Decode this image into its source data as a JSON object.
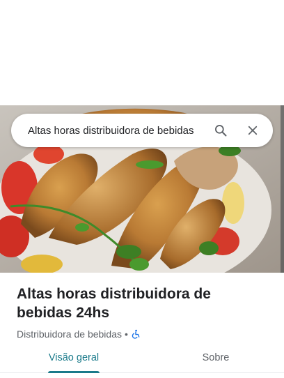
{
  "search": {
    "value": "Altas horas distribuidora de bebidas",
    "search_icon": "search-icon",
    "close_icon": "close-icon"
  },
  "place": {
    "title": "Altas horas distribuidora de bebidas 24hs",
    "category": "Distribuidora de bebidas",
    "separator": "•",
    "accessibility_icon": "wheelchair-icon"
  },
  "tabs": [
    {
      "label": "Visão geral",
      "active": true
    },
    {
      "label": "Sobre",
      "active": false
    }
  ],
  "colors": {
    "accent": "#1a7a8a",
    "text_primary": "#202124",
    "text_secondary": "#5f6368",
    "accessibility_icon": "#1a73e8"
  }
}
